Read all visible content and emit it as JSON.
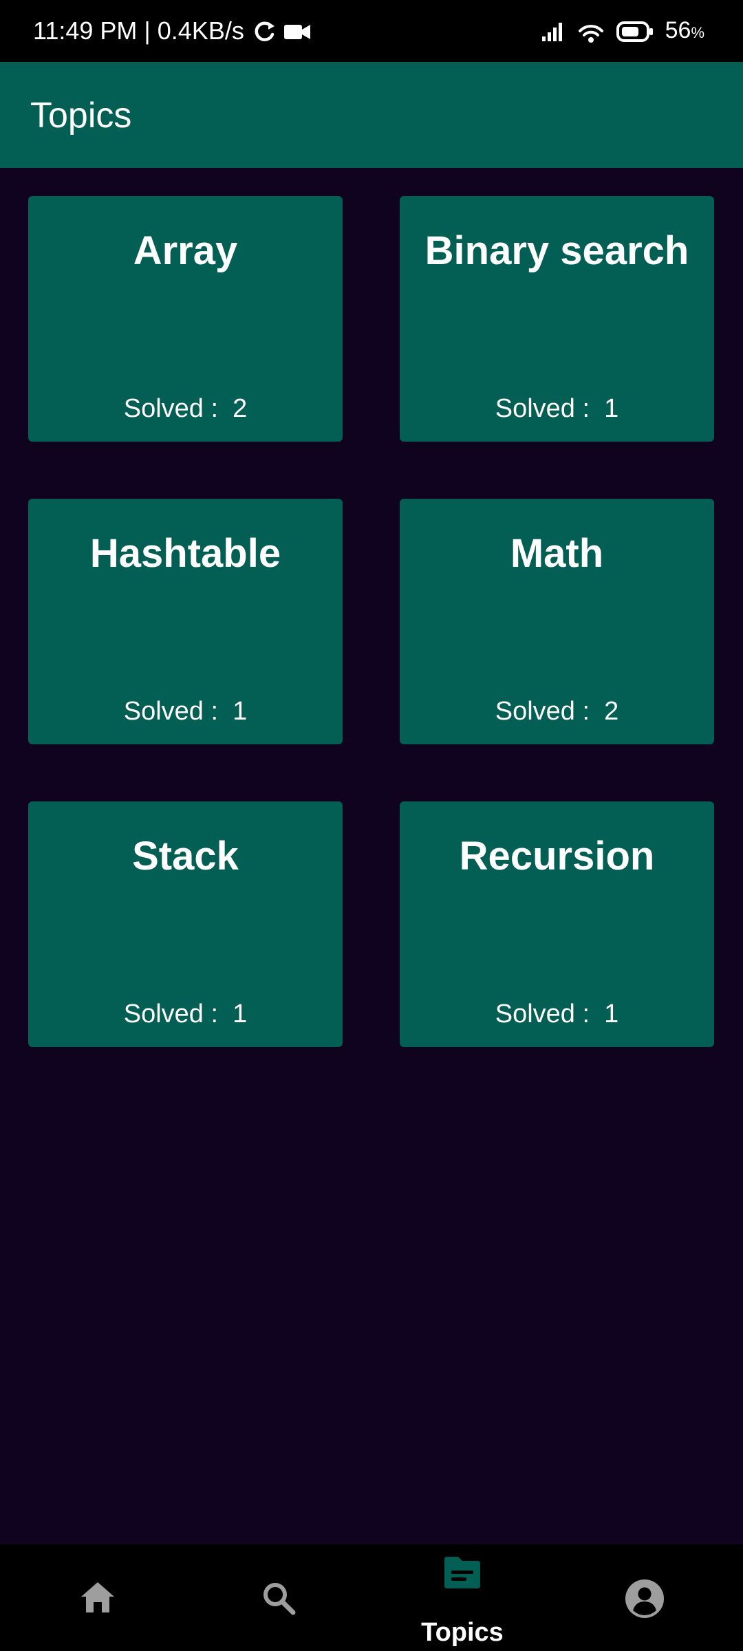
{
  "status_bar": {
    "time": "11:49 PM | 0.4KB/s",
    "battery": "56",
    "battery_unit": "%",
    "icons": [
      "sync-icon",
      "video-camera-icon",
      "cellular-signal-icon",
      "wifi-icon",
      "battery-icon"
    ]
  },
  "app_bar": {
    "title": "Topics"
  },
  "topics": [
    {
      "name": "Array",
      "solved": "Solved :  2"
    },
    {
      "name": "Binary search",
      "solved": "Solved :  1"
    },
    {
      "name": "Hashtable",
      "solved": "Solved :  1"
    },
    {
      "name": "Math",
      "solved": "Solved :  2"
    },
    {
      "name": "Stack",
      "solved": "Solved :  1"
    },
    {
      "name": "Recursion",
      "solved": "Solved :  1"
    }
  ],
  "bottom_nav": {
    "items": [
      {
        "icon": "home-icon",
        "label": "",
        "active": false
      },
      {
        "icon": "search-icon",
        "label": "",
        "active": false
      },
      {
        "icon": "topics-folder-icon",
        "label": "Topics",
        "active": true
      },
      {
        "icon": "account-icon",
        "label": "",
        "active": false
      }
    ]
  },
  "colors": {
    "background": "#10031f",
    "primary": "#035e53",
    "bars": "#000000",
    "nav_inactive": "#9e9e9e",
    "text": "#ffffff"
  }
}
